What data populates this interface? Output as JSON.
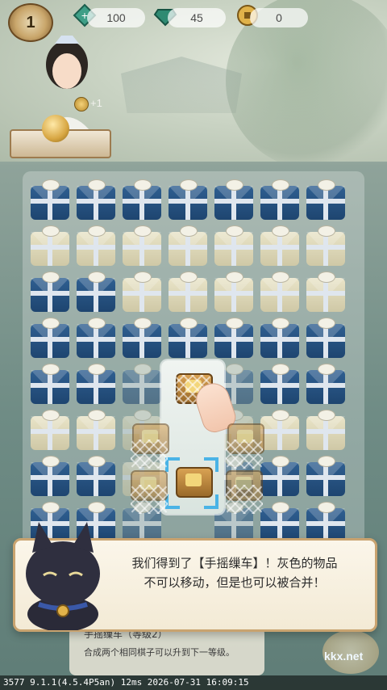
{
  "header": {
    "level": "1",
    "stats": [
      {
        "icon": "jade-icon",
        "value": "100"
      },
      {
        "icon": "gem-icon",
        "value": "45"
      },
      {
        "icon": "coin-icon",
        "value": "0"
      }
    ]
  },
  "character": {
    "coin_bonus": "+1"
  },
  "board": {
    "cols": 7,
    "rows": 8,
    "cells": [
      [
        "blue",
        "blue",
        "blue",
        "blue",
        "blue",
        "blue",
        "blue"
      ],
      [
        "pale",
        "pale",
        "pale",
        "pale",
        "pale",
        "pale",
        "pale"
      ],
      [
        "blue",
        "blue",
        "pale",
        "pale",
        "pale",
        "pale",
        "pale"
      ],
      [
        "blue",
        "blue",
        "blue",
        "blue",
        "blue",
        "blue",
        "blue"
      ],
      [
        "blue",
        "blue",
        "blue",
        "empty",
        "blue",
        "blue",
        "blue"
      ],
      [
        "pale",
        "pale",
        "pale",
        "empty",
        "pale",
        "pale",
        "pale"
      ],
      [
        "blue",
        "blue",
        "pale",
        "empty",
        "blue",
        "blue",
        "blue"
      ],
      [
        "blue",
        "blue",
        "blue",
        "empty",
        "blue",
        "blue",
        "blue"
      ]
    ]
  },
  "dialog": {
    "line1": "我们得到了【手摇缫车】！灰色的物品",
    "line2": "不可以移动，但是也可以被合并！"
  },
  "item_detail": {
    "title": "手摇缫车（等级2）",
    "body": "合成两个相同棋子可以升到下一等级。"
  },
  "watermark": "kkx.net",
  "statusbar": "3577 9.1.1(4.5.4P5an) 12ms 2026-07-31 16:09:15",
  "colors": {
    "accent": "#4ab3e6",
    "dialog_border": "#c9a36f",
    "gift_blue": "#2f5f91"
  }
}
